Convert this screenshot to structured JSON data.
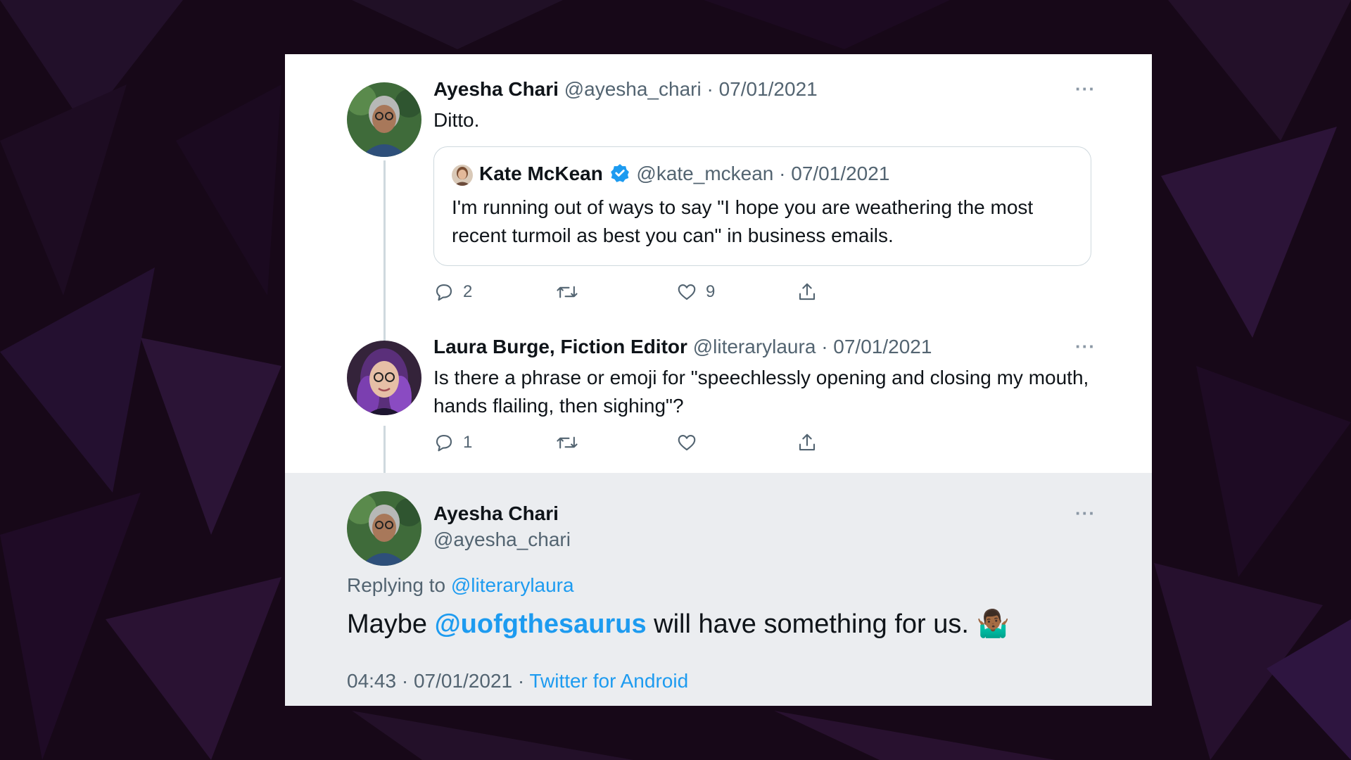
{
  "tweets": [
    {
      "name": "Ayesha Chari",
      "handle": "@ayesha_chari",
      "date": "· 07/01/2021",
      "text": "Ditto.",
      "quote": {
        "name": "Kate McKean",
        "handle": "@kate_mckean",
        "date": "· 07/01/2021",
        "text": "I'm running out of ways to say \"I hope you are weathering the most recent turmoil as best you can\" in business emails."
      },
      "replies": "2",
      "retweets": "",
      "likes": "9"
    },
    {
      "name": "Laura Burge, Fiction Editor",
      "handle": "@literarylaura",
      "date": "· 07/01/2021",
      "text": "Is there a phrase or emoji for \"speechlessly opening and closing my mouth, hands flailing, then sighing\"?",
      "replies": "1",
      "retweets": "",
      "likes": ""
    }
  ],
  "main": {
    "name": "Ayesha Chari",
    "handle": "@ayesha_chari",
    "replying_label": "Replying to",
    "replying_handle": "@literarylaura",
    "text_before": "Maybe",
    "mention": "@uofgthesaurus",
    "text_after": "will have something for us.",
    "emoji": "🤷🏾‍♂️",
    "time": "04:43 · 07/01/2021 ·",
    "source": "Twitter for Android"
  },
  "more_label": "···",
  "colors": {
    "accent": "#1d9bf0",
    "background": "#170818",
    "highlight": "#ebedf0"
  }
}
